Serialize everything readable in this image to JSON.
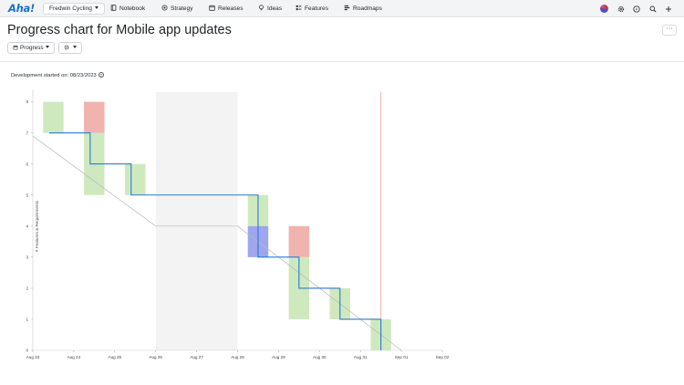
{
  "nav": {
    "logo": "Aha!",
    "workspace": "Fredwin Cycling",
    "items": [
      {
        "label": "Notebook",
        "icon": "notebook-icon"
      },
      {
        "label": "Strategy",
        "icon": "strategy-icon"
      },
      {
        "label": "Releases",
        "icon": "calendar-icon"
      },
      {
        "label": "Ideas",
        "icon": "lightbulb-icon"
      },
      {
        "label": "Features",
        "icon": "features-icon"
      },
      {
        "label": "Roadmaps",
        "icon": "roadmap-icon"
      }
    ],
    "right_icons": [
      "avatar",
      "settings-icon",
      "help-icon",
      "search-icon",
      "add-icon"
    ]
  },
  "page": {
    "title": "Progress chart for Mobile app updates",
    "more_label": "···",
    "view_button": "Progress",
    "dev_started": "Development started on: 08/23/2023",
    "help_glyph": "?"
  },
  "chart_data": {
    "type": "step-line",
    "ylabel": "# Features & Requirements",
    "y_ticks": [
      0,
      1,
      2,
      3,
      4,
      5,
      6,
      7,
      8
    ],
    "ylim": [
      0,
      8.4
    ],
    "x_ticks": [
      "Aug 23",
      "Aug 24",
      "Aug 25",
      "Aug 26",
      "Aug 27",
      "Aug 28",
      "Aug 29",
      "Aug 30",
      "Aug 31",
      "Sep 01",
      "Sep 02"
    ],
    "xlim": [
      0,
      10
    ],
    "weekend_shade": [
      3,
      5
    ],
    "today_line_x": 8.5,
    "colors": {
      "line": "#2a78d6",
      "ideal": "#b8b8b8",
      "added": "#f0b3ae",
      "completed": "#cfe9bf",
      "changed": "#9ea6ee",
      "today": "#f5a58e",
      "weekend": "#f3f3f3"
    },
    "actual": [
      [
        0.4,
        7
      ],
      [
        1.4,
        7
      ],
      [
        1.4,
        6
      ],
      [
        2.4,
        6
      ],
      [
        2.4,
        5
      ],
      [
        5.5,
        5
      ],
      [
        5.5,
        3
      ],
      [
        6.5,
        3
      ],
      [
        6.5,
        2
      ],
      [
        7.5,
        2
      ],
      [
        7.5,
        1
      ],
      [
        8.5,
        1
      ],
      [
        8.5,
        0
      ]
    ],
    "ideal": [
      [
        0,
        6.9
      ],
      [
        3,
        4
      ],
      [
        5,
        4
      ],
      [
        9,
        0
      ]
    ],
    "bars": [
      {
        "x": 0.5,
        "from": 7,
        "to": 8,
        "kind": "completed"
      },
      {
        "x": 1.5,
        "from": 7,
        "to": 8,
        "kind": "added"
      },
      {
        "x": 1.5,
        "from": 5,
        "to": 7,
        "kind": "completed"
      },
      {
        "x": 2.5,
        "from": 5,
        "to": 6,
        "kind": "completed"
      },
      {
        "x": 5.5,
        "from": 4,
        "to": 5,
        "kind": "completed"
      },
      {
        "x": 5.5,
        "from": 3,
        "to": 4,
        "kind": "changed"
      },
      {
        "x": 6.5,
        "from": 3,
        "to": 4,
        "kind": "added"
      },
      {
        "x": 6.5,
        "from": 1,
        "to": 3,
        "kind": "completed"
      },
      {
        "x": 7.5,
        "from": 1,
        "to": 2,
        "kind": "completed"
      },
      {
        "x": 8.5,
        "from": 0,
        "to": 1,
        "kind": "completed"
      }
    ]
  }
}
